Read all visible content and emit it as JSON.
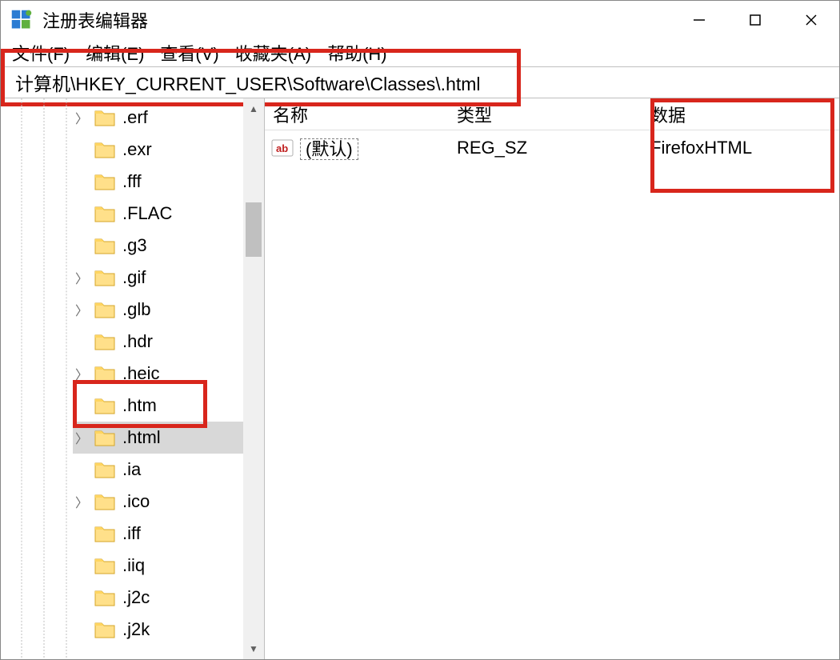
{
  "window": {
    "title": "注册表编辑器"
  },
  "menu": {
    "file": "文件(F)",
    "edit": "编辑(E)",
    "view": "查看(V)",
    "favorites": "收藏夹(A)",
    "help": "帮助(H)"
  },
  "address": "计算机\\HKEY_CURRENT_USER\\Software\\Classes\\.html",
  "tree": {
    "items": [
      {
        "label": ".erf",
        "expandable": true
      },
      {
        "label": ".exr",
        "expandable": false
      },
      {
        "label": ".fff",
        "expandable": false
      },
      {
        "label": ".FLAC",
        "expandable": false
      },
      {
        "label": ".g3",
        "expandable": false
      },
      {
        "label": ".gif",
        "expandable": true
      },
      {
        "label": ".glb",
        "expandable": true
      },
      {
        "label": ".hdr",
        "expandable": false
      },
      {
        "label": ".heic",
        "expandable": true
      },
      {
        "label": ".htm",
        "expandable": false
      },
      {
        "label": ".html",
        "expandable": true,
        "selected": true
      },
      {
        "label": ".ia",
        "expandable": false
      },
      {
        "label": ".ico",
        "expandable": true
      },
      {
        "label": ".iff",
        "expandable": false
      },
      {
        "label": ".iiq",
        "expandable": false
      },
      {
        "label": ".j2c",
        "expandable": false
      },
      {
        "label": ".j2k",
        "expandable": false
      }
    ]
  },
  "list": {
    "headers": {
      "name": "名称",
      "type": "类型",
      "data": "数据"
    },
    "rows": [
      {
        "name": "(默认)",
        "type": "REG_SZ",
        "data": "FirefoxHTML"
      }
    ]
  }
}
